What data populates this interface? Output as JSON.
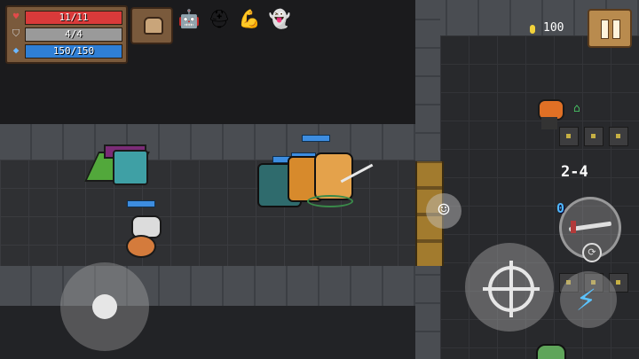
{
  "hud": {
    "health": {
      "text": "11/11",
      "icon": "heart-icon",
      "color": "#d93a3a",
      "fraction": 1.0
    },
    "armor": {
      "text": "4/4",
      "icon": "shield-icon",
      "color": "#9a9a9a",
      "fraction": 1.0
    },
    "energy": {
      "text": "150/150",
      "icon": "diamond-icon",
      "color": "#2f7fd6",
      "fraction": 1.0
    },
    "coins": "100",
    "level": "2-4",
    "weapon_energy_cost": "0"
  },
  "buffs": [
    {
      "name": "robot-buff-icon",
      "glyph": "🤖"
    },
    {
      "name": "helmet-buff-icon",
      "glyph": "⛑"
    },
    {
      "name": "muscle-buff-icon",
      "glyph": "💪"
    },
    {
      "name": "ghost-buff-icon",
      "glyph": "👻"
    }
  ],
  "icons": {
    "emote": "☺",
    "home": "⌂",
    "swap": "⟳",
    "lightning": "⚡"
  }
}
